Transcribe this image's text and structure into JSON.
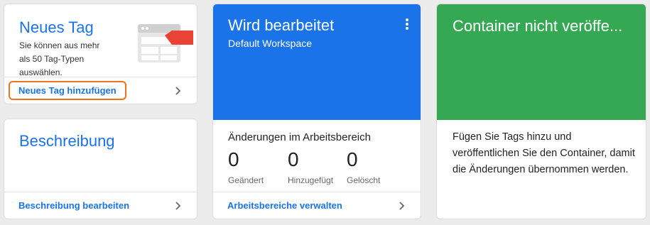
{
  "new_tag_card": {
    "title": "Neues Tag",
    "description": "Sie können aus mehr als 50 Tag-Typen auswählen.",
    "link_label": "Neues Tag hinzufügen"
  },
  "description_card": {
    "title": "Beschreibung",
    "link_label": "Beschreibung bearbeiten"
  },
  "workspace_card": {
    "title": "Wird bearbeitet",
    "subtitle": "Default Workspace",
    "changes_title": "Änderungen im Arbeitsbereich",
    "stats": [
      {
        "value": "0",
        "label": "Geändert"
      },
      {
        "value": "0",
        "label": "Hinzugefügt"
      },
      {
        "value": "0",
        "label": "Gelöscht"
      }
    ],
    "link_label": "Arbeitsbereiche verwalten",
    "header_color": "#1a73e8"
  },
  "container_card": {
    "title": "Container nicht veröffe...",
    "body": "Fügen Sie Tags hinzu und veröffentlichen Sie den Container, damit die Änderungen übernommen werden.",
    "header_color": "#34a853"
  },
  "icons": {
    "chevron": "chevron-right-icon",
    "kebab": "more-vert-icon",
    "illustration": "tag-illustration-icon"
  },
  "colors": {
    "accent": "#1a73e8",
    "highlight": "#f0731c",
    "tag_arrow": "#ea4335"
  }
}
